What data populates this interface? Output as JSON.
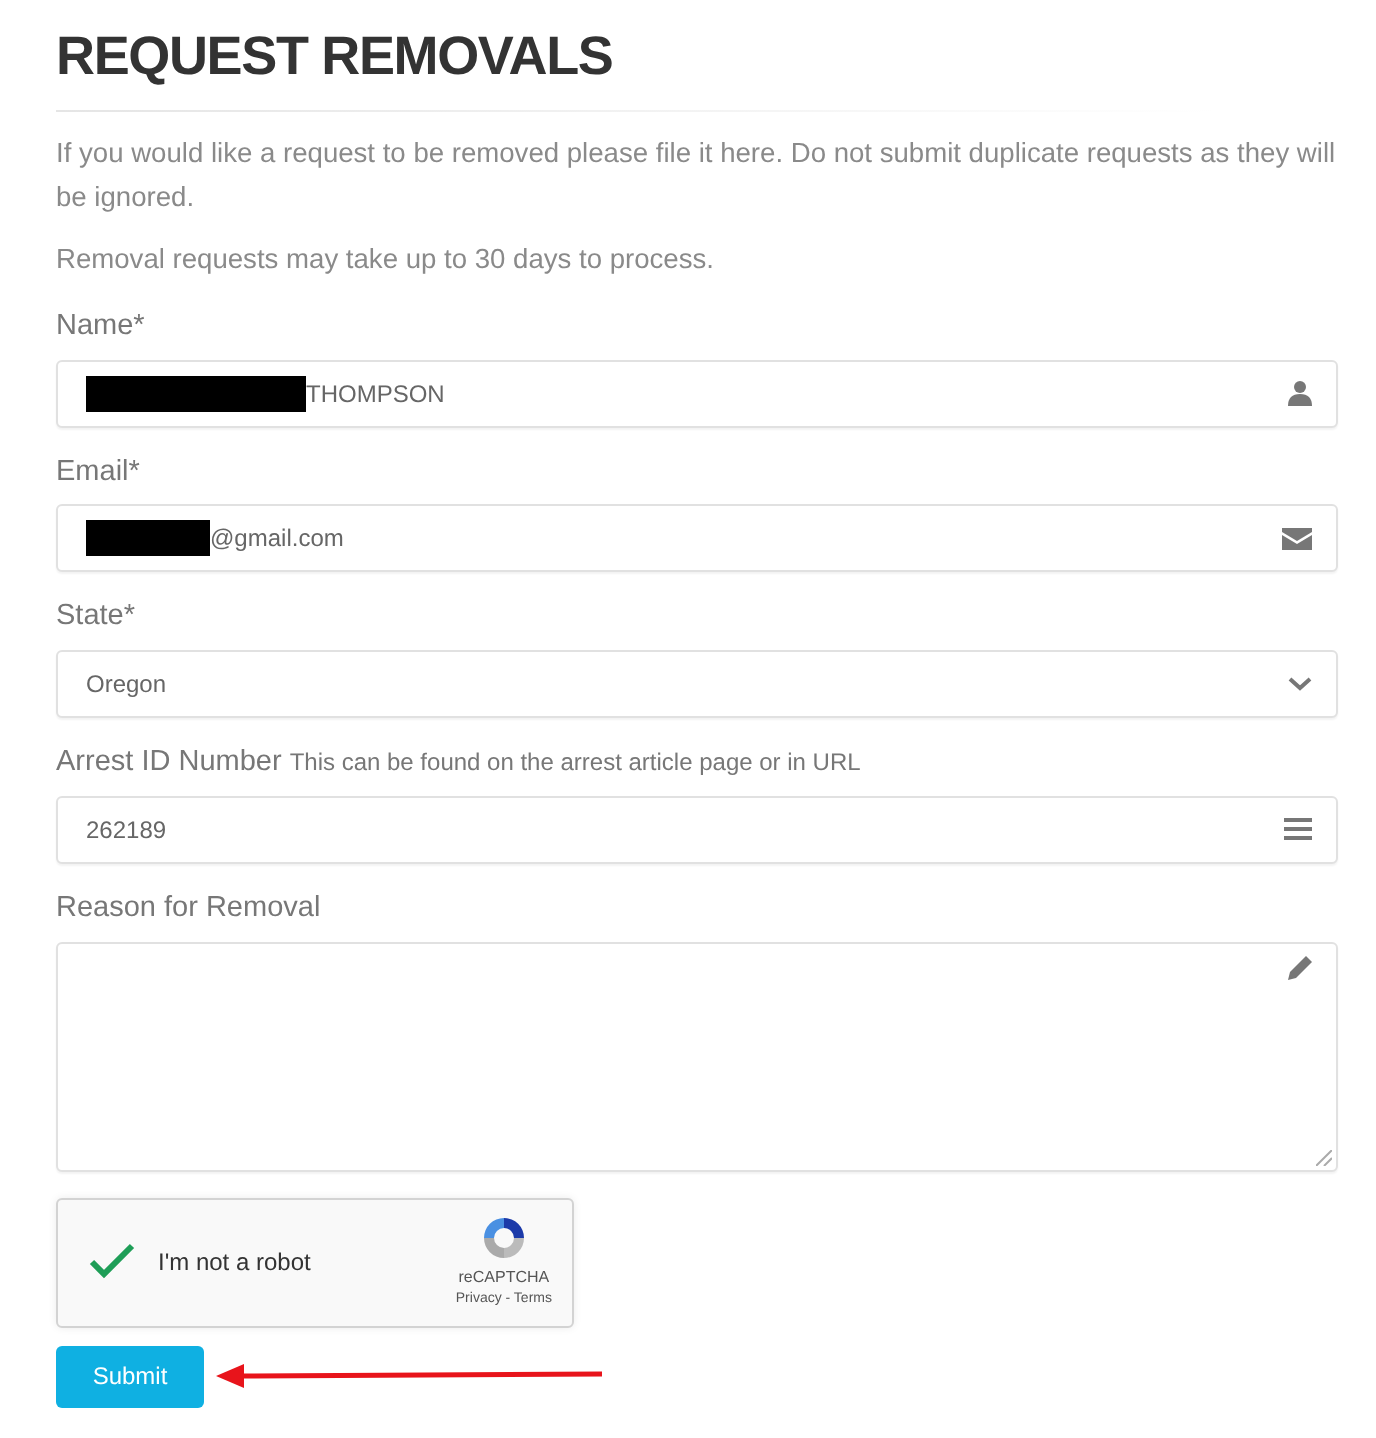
{
  "title": "REQUEST REMOVALS",
  "intro": [
    "If you would like a request to be removed please file it here. Do not submit duplicate requests as they will be ignored.",
    "Removal requests may take up to 30 days to process."
  ],
  "fields": [
    {
      "kind": "name",
      "label": "Name*",
      "value": "THOMPSON",
      "redacted": true
    },
    {
      "kind": "email",
      "label": "Email*",
      "value": "@gmail.com",
      "redacted": true
    },
    {
      "kind": "select",
      "label": "State*",
      "value": "Oregon"
    },
    {
      "kind": "number",
      "label": "Arrest ID Number",
      "hint": "This can be found on the arrest article page or in URL",
      "value": "262189"
    },
    {
      "kind": "textarea",
      "label": "Reason for Removal"
    }
  ],
  "captcha": {
    "label": "I'm not a robot",
    "checked": true,
    "brand": "reCAPTCHA",
    "links": "Privacy - Terms"
  },
  "submit": "Submit"
}
